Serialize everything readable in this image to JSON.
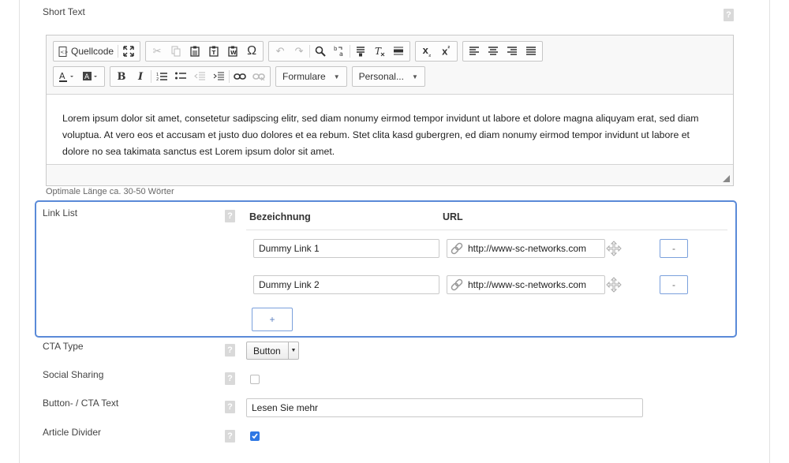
{
  "short_text": {
    "label": "Short Text",
    "help": "?",
    "toolbar": {
      "source_label": "Quellcode",
      "format_label": "Formulare",
      "style_label": "Personal..."
    },
    "content": "Lorem ipsum dolor sit amet, consetetur sadipscing elitr, sed diam nonumy eirmod tempor invidunt ut labore et dolore magna aliquyam erat, sed diam voluptua. At vero eos et accusam et justo duo dolores et ea rebum. Stet clita kasd gubergren, ed diam nonumy eirmod tempor invidunt ut labore et dolore no sea takimata sanctus est Lorem ipsum dolor sit amet.",
    "hint": "Optimale Länge ca. 30-50 Wörter"
  },
  "link_list": {
    "label": "Link List",
    "help": "?",
    "col_name": "Bezeichnung",
    "col_url": "URL",
    "rows": [
      {
        "name": "Dummy Link 1",
        "url": "http://www-sc-networks.com",
        "remove": "-"
      },
      {
        "name": "Dummy Link 2",
        "url": "http://www-sc-networks.com",
        "remove": "-"
      }
    ],
    "add_label": "+"
  },
  "cta_type": {
    "label": "CTA Type",
    "help": "?",
    "value": "Button"
  },
  "social_sharing": {
    "label": "Social Sharing",
    "help": "?",
    "checked": false
  },
  "button_text": {
    "label": "Button- / CTA Text",
    "help": "?",
    "value": "Lesen Sie mehr"
  },
  "article_divider": {
    "label": "Article Divider",
    "help": "?",
    "checked": true
  },
  "colors": {
    "accent": "#5a8ad8",
    "check": "#2f78e4"
  }
}
